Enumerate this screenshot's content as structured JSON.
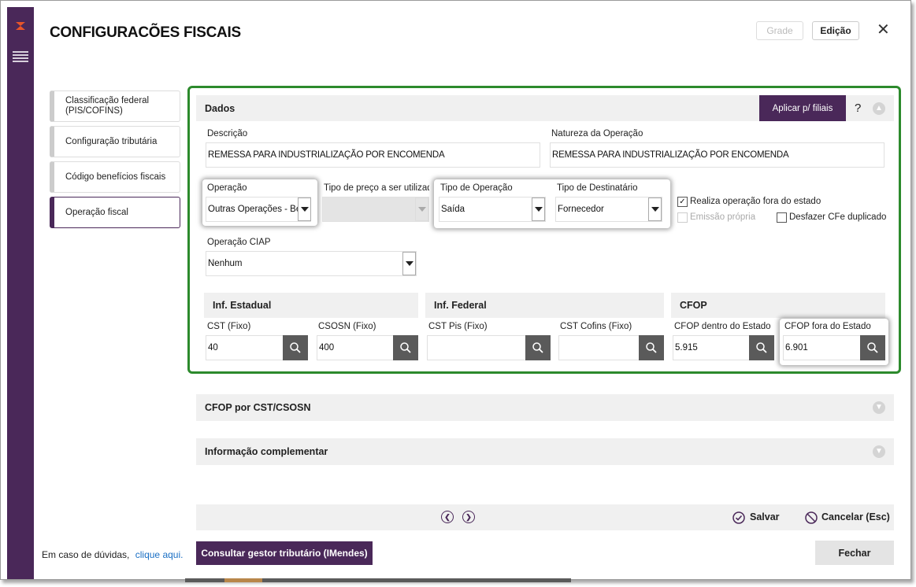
{
  "window": {
    "title": "CONFIGURACÕES FISCAIS",
    "btn_grade": "Grade",
    "btn_edicao": "Edição",
    "close": "✕"
  },
  "sidebar": {
    "items": [
      {
        "label": "Classificação federal (PIS/COFINS)"
      },
      {
        "label": "Configuração tributária"
      },
      {
        "label": "Código benefícios fiscais"
      },
      {
        "label": "Operação fiscal"
      }
    ]
  },
  "dados": {
    "header": "Dados",
    "aplicar_label": "Aplicar p/ filiais",
    "help": "?",
    "descricao_label": "Descrição",
    "descricao_value": "REMESSA PARA INDUSTRIALIZAÇÃO POR ENCOMENDA",
    "natureza_label": "Natureza da Operação",
    "natureza_value": "REMESSA PARA INDUSTRIALIZAÇÃO POR ENCOMENDA",
    "operacao_label": "Operação",
    "operacao_value": "Outras Operações - Ben",
    "tipo_preco_label": "Tipo de preço a ser utilizado",
    "tipo_preco_value": "",
    "tipo_operacao_label": "Tipo de Operação",
    "tipo_operacao_value": "Saída",
    "tipo_destinatario_label": "Tipo de Destinatário",
    "tipo_destinatario_value": "Fornecedor",
    "realiza_fora_label": "Realiza operação fora do estado",
    "realiza_fora_checked": true,
    "emissao_propria_label": "Emissão própria",
    "desfazer_label": "Desfazer CFe duplicado",
    "operacao_ciap_label": "Operação CIAP",
    "operacao_ciap_value": "Nenhum"
  },
  "estadual": {
    "header": "Inf. Estadual",
    "cst_label": "CST (Fixo)",
    "cst_value": "40",
    "csosn_label": "CSOSN (Fixo)",
    "csosn_value": "400"
  },
  "federal": {
    "header": "Inf. Federal",
    "cst_pis_label": "CST Pis (Fixo)",
    "cst_pis_value": "",
    "cst_cofins_label": "CST Cofins (Fixo)",
    "cst_cofins_value": ""
  },
  "cfop": {
    "header": "CFOP",
    "dentro_label": "CFOP dentro do Estado",
    "dentro_value": "5.915",
    "fora_label": "CFOP fora do Estado",
    "fora_value": "6.901"
  },
  "sections": {
    "cfop_cst": "CFOP por CST/CSOSN",
    "info_comp": "Informação complementar"
  },
  "footer": {
    "salvar": "Salvar",
    "cancelar": "Cancelar (Esc)",
    "help_text": "Em caso de dúvidas,",
    "help_link": "clique aqui.",
    "consultar": "Consultar gestor tributário (IMendes)",
    "fechar": "Fechar"
  },
  "colors": {
    "brand_purple": "#4a2859",
    "highlight_green": "#2c8a2c",
    "search_button": "#5a5a5a"
  }
}
